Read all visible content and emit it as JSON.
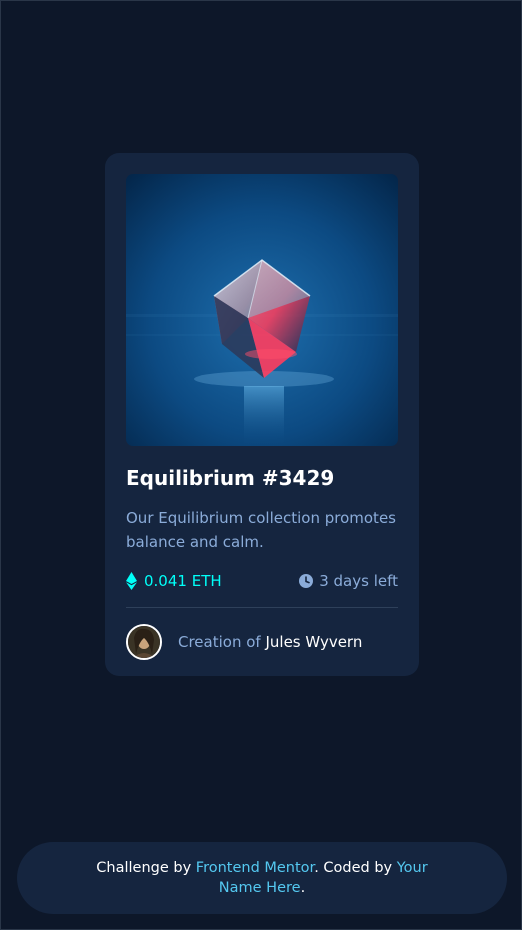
{
  "card": {
    "image_alt": "Equilibrium cube",
    "title": "Equilibrium #3429",
    "description": "Our Equilibrium collection promotes balance and calm.",
    "price": "0.041 ETH",
    "time_left": "3 days left",
    "creator_prefix": "Creation of ",
    "creator_name": "Jules Wyvern",
    "price_icon": "ethereum-icon",
    "time_icon": "clock-icon"
  },
  "footer": {
    "prefix": "Challenge by ",
    "link1": "Frontend Mentor",
    "middle": ". Coded by ",
    "link2": "Your Name Here",
    "suffix": "."
  },
  "colors": {
    "background": "#0d1729",
    "card": "#15253f",
    "cyan": "#00fff8",
    "soft_blue": "#8bacd9",
    "link": "#54c8f0"
  }
}
